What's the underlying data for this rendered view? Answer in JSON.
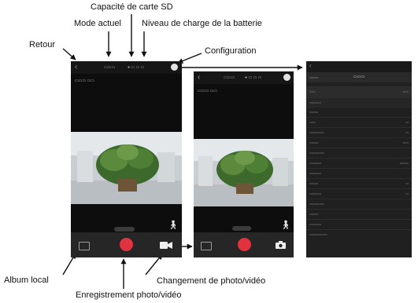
{
  "callouts": {
    "sd_capacity": "Capacité de carte SD",
    "current_mode": "Mode actuel",
    "battery_level": "Niveau de charge de la batterie",
    "back": "Retour",
    "configuration": "Configuration",
    "local_album": "Album local",
    "photo_video_switch": "Changement de photo/vidéo",
    "photo_video_record": "Enregistrement photo/vidéo"
  },
  "icons": {
    "back": "chevron-left-icon",
    "settings": "gear-icon",
    "album": "album-icon",
    "record": "record-button-icon",
    "video_mode": "video-camera-icon",
    "photo_mode": "camera-icon",
    "motion": "walking-person-icon"
  },
  "colors": {
    "record_button": "#e0323f",
    "app_background": "#0d0d0d",
    "settings_background": "#202020"
  }
}
